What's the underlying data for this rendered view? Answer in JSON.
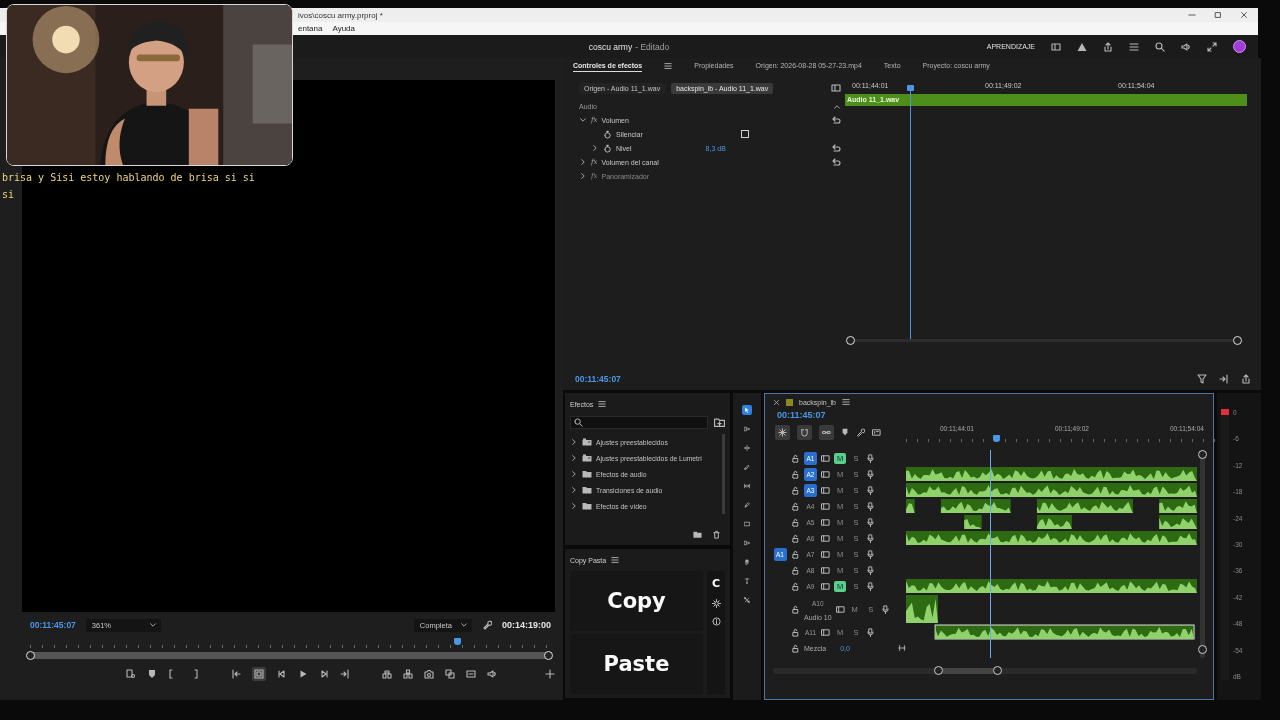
{
  "window": {
    "path": "ivos\\coscu army.prproj *",
    "menu": [
      "entana",
      "Ayuda"
    ],
    "title": "coscu army",
    "status": "- Editado",
    "workspace": "APRENDIZAJE"
  },
  "overlay": {
    "webcam": {
      "kind": "picture"
    },
    "chat": [
      "brisa y Sisi estoy hablando de brisa si si",
      "si"
    ]
  },
  "program_monitor": {
    "timecode": "00:11:45:07",
    "zoom": "361%",
    "quality": "Completa",
    "duration": "00:14:19:00",
    "playhead": {
      "level": 0.82
    },
    "safe_margins_on": true
  },
  "effect_controls": {
    "tabs": [
      {
        "label": "Controles de efectos",
        "selected": true
      },
      {
        "label": "Propiedades",
        "selected": false
      },
      {
        "label": "Origen: 2026-08-28 05-27-23.mp4",
        "selected": false
      },
      {
        "label": "Texto",
        "selected": false
      },
      {
        "label": "Proyecto: coscu army",
        "selected": false
      }
    ],
    "clip_tabs": [
      {
        "label": "Origen - Audio 11_1.wav",
        "selected": false
      },
      {
        "label": "backspin_lb - Audio 11_1.wav",
        "selected": true
      }
    ],
    "section": "Audio",
    "effects": [
      {
        "badge": "fx",
        "label": "Volumen",
        "expanded": true,
        "enabled": true,
        "reset": true,
        "children": [
          {
            "kind": "checkbox",
            "label": "Silenciar",
            "checked": false
          },
          {
            "kind": "value",
            "label": "Nivel",
            "value": "8,3 dB",
            "expanded": false,
            "reset": true
          }
        ]
      },
      {
        "badge": "fx",
        "label": "Volumen del canal",
        "expanded": false,
        "enabled": true,
        "reset": true
      },
      {
        "badge": "fx",
        "label": "Panoramizador",
        "expanded": false,
        "enabled": false,
        "reset": false
      }
    ],
    "ruler": [
      "00:11;44:01",
      "00:11;49:02",
      "00:11;54:04"
    ],
    "clip": "Audio 11_1.wav",
    "playhead": {
      "level": 0.16
    },
    "timecode": "00:11:45:07"
  },
  "effects_panel": {
    "title": "Efectos",
    "items": [
      {
        "kind": "preset",
        "label": "Ajustes preestablecidos",
        "expanded": false
      },
      {
        "kind": "preset",
        "label": "Ajustes preestablecidos de Lumetri",
        "expanded": false
      },
      {
        "kind": "folder",
        "label": "Efectos de audio",
        "expanded": false
      },
      {
        "kind": "folder",
        "label": "Transiciones de audio",
        "expanded": false
      },
      {
        "kind": "folder",
        "label": "Efectos de vídeo",
        "expanded": false
      }
    ]
  },
  "copy_pasta": {
    "title": "Copy Pasta",
    "logo": "C",
    "buttons": [
      "Copy",
      "Paste"
    ]
  },
  "tools": [
    {
      "kind": "select",
      "selected": true
    },
    {
      "kind": "track-select",
      "selected": false
    },
    {
      "kind": "ripple",
      "selected": false
    },
    {
      "kind": "razor",
      "selected": false
    },
    {
      "kind": "slip",
      "selected": false
    },
    {
      "kind": "pen",
      "selected": false
    },
    {
      "kind": "rectangle",
      "selected": false
    },
    {
      "kind": "track-select",
      "selected": false
    },
    {
      "kind": "hand",
      "selected": false
    },
    {
      "kind": "type",
      "selected": false
    },
    {
      "kind": "remix",
      "selected": false
    }
  ],
  "timeline": {
    "sequence": "backspin_lb",
    "timecode": "00:11:45:07",
    "ruler": [
      "00:11;44:01",
      "00:11;49:02",
      "00:11;54:04"
    ],
    "playhead": {
      "level": 0.29
    },
    "tracks": [
      {
        "name": "A1",
        "targeted": true,
        "muted": true,
        "mute_label": "M",
        "solo_label": "S"
      },
      {
        "name": "A2",
        "targeted": true,
        "muted": false,
        "mute_label": "M",
        "solo_label": "S"
      },
      {
        "name": "A3",
        "targeted": true,
        "muted": false,
        "mute_label": "M",
        "solo_label": "S"
      },
      {
        "name": "A4",
        "targeted": false,
        "muted": false,
        "mute_label": "M",
        "solo_label": "S"
      },
      {
        "name": "A5",
        "targeted": false,
        "muted": false,
        "mute_label": "M",
        "solo_label": "S"
      },
      {
        "name": "A6",
        "targeted": false,
        "muted": false,
        "mute_label": "M",
        "solo_label": "S"
      },
      {
        "name": "A7",
        "targeted": false,
        "muted": false,
        "mute_label": "M",
        "solo_label": "S",
        "source": "A1"
      },
      {
        "name": "A8",
        "targeted": false,
        "muted": false,
        "mute_label": "M",
        "solo_label": "S"
      },
      {
        "name": "A9",
        "targeted": false,
        "muted": true,
        "mute_label": "M",
        "solo_label": "S"
      },
      {
        "name": "A10",
        "label": "Audio 10",
        "targeted": false,
        "muted": false,
        "mute_label": "M",
        "solo_label": "S"
      },
      {
        "name": "A11",
        "targeted": false,
        "muted": false,
        "mute_label": "M",
        "solo_label": "S"
      }
    ],
    "mix": {
      "label": "Mezcla",
      "value": "0,0"
    }
  },
  "meter": {
    "ticks": [
      "0",
      "-6",
      "-12",
      "-18",
      "-24",
      "-30",
      "-36",
      "-42",
      "-48",
      "-54",
      "dB"
    ]
  }
}
